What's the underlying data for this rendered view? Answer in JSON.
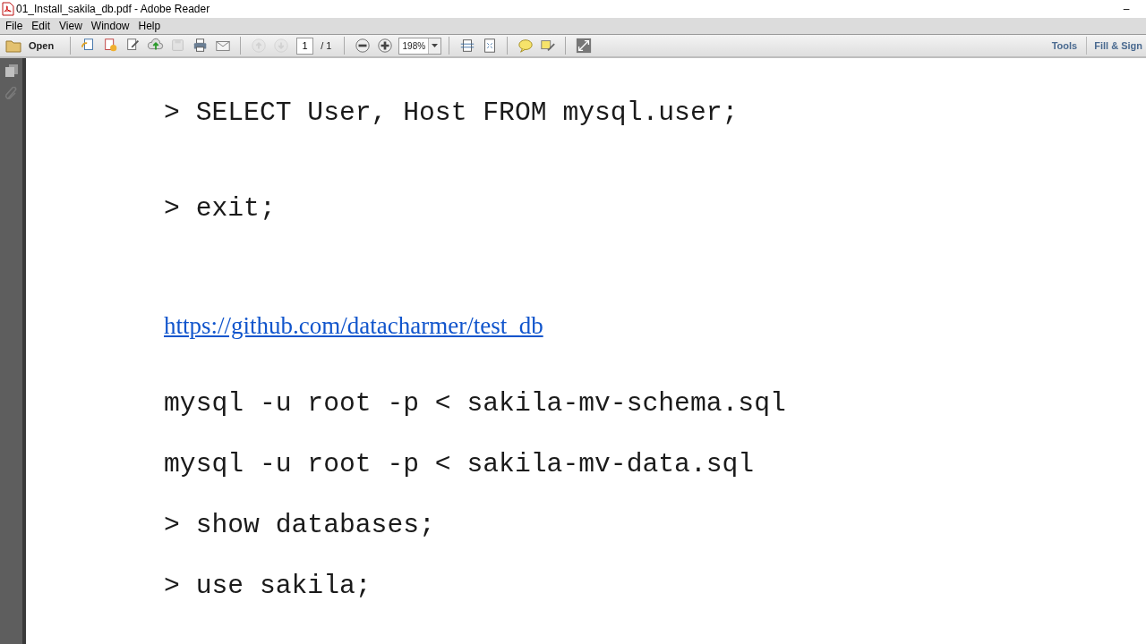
{
  "window": {
    "title": "01_Install_sakila_db.pdf - Adobe Reader",
    "controls": [
      "–"
    ]
  },
  "menu": [
    "File",
    "Edit",
    "View",
    "Window",
    "Help"
  ],
  "toolbar": {
    "open": "Open",
    "tools_left": [
      {
        "kind": "create",
        "disabled": false
      },
      {
        "kind": "convert",
        "disabled": false
      },
      {
        "kind": "edit",
        "disabled": false
      },
      {
        "kind": "upload",
        "disabled": false
      },
      {
        "kind": "save",
        "disabled": true
      },
      {
        "kind": "print",
        "disabled": false
      },
      {
        "kind": "mail",
        "disabled": false
      }
    ],
    "nav": [
      {
        "kind": "up",
        "disabled": true
      },
      {
        "kind": "down",
        "disabled": true
      }
    ],
    "page": "1",
    "page_total": "/ 1",
    "zoom": "198%",
    "tools_right": [
      {
        "kind": "fitpage",
        "disabled": false
      },
      {
        "kind": "fitwidth",
        "disabled": false
      },
      {
        "kind": "comment",
        "disabled": false
      },
      {
        "kind": "highlight",
        "disabled": false
      },
      {
        "kind": "fullscreen",
        "disabled": false
      }
    ],
    "links": [
      "Tools",
      "Fill & Sign"
    ]
  },
  "document": {
    "lines": [
      {
        "kind": "code",
        "text": "> SELECT User, Host FROM mysql.user;"
      },
      {
        "kind": "code",
        "text": "> exit;"
      },
      {
        "kind": "link",
        "text": "https://github.com/datacharmer/test_db"
      },
      {
        "kind": "code",
        "text": "mysql -u root -p < sakila-mv-schema.sql"
      },
      {
        "kind": "code",
        "text": "mysql -u root -p < sakila-mv-data.sql"
      },
      {
        "kind": "code",
        "text": "> show databases;"
      },
      {
        "kind": "code",
        "text": "> use sakila;"
      }
    ]
  }
}
